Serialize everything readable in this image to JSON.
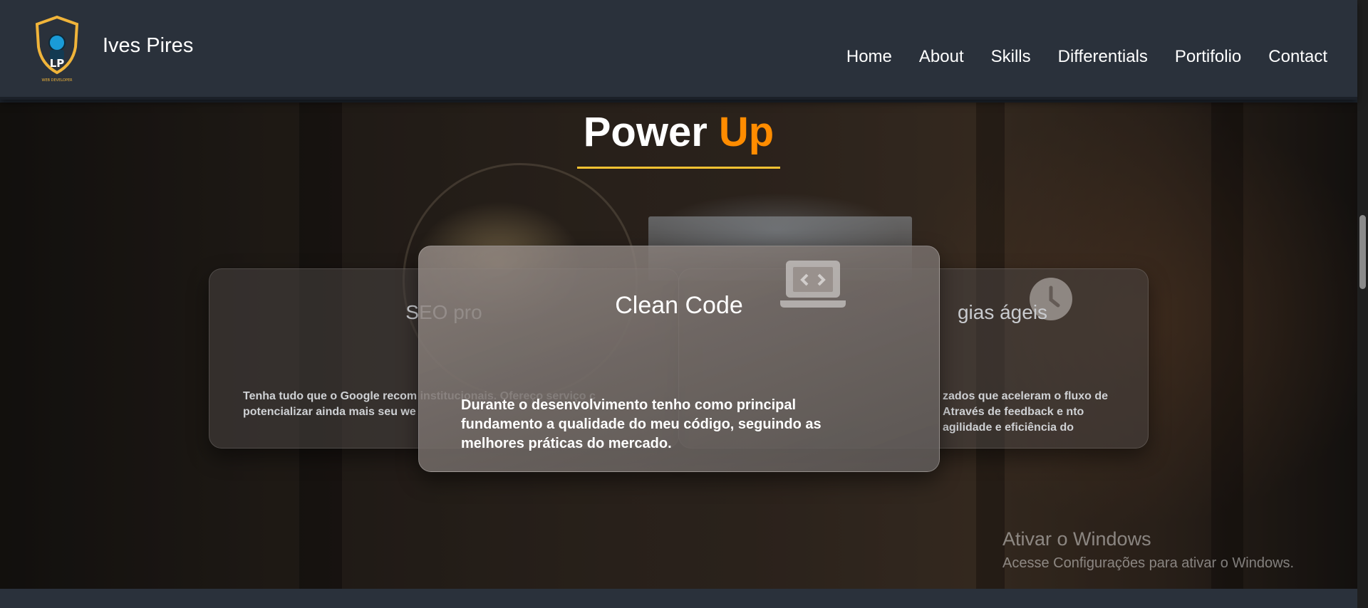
{
  "header": {
    "brand": "Ives Pires",
    "logo_caption": "WEB DEVELOPER",
    "logo_letters": "LP",
    "nav": [
      {
        "label": "Home"
      },
      {
        "label": "About"
      },
      {
        "label": "Skills"
      },
      {
        "label": "Differentials"
      },
      {
        "label": "Portifolio"
      },
      {
        "label": "Contact"
      }
    ]
  },
  "section": {
    "title_main": "Power ",
    "title_accent": "Up",
    "accent_color": "#ff8c00",
    "underline_color": "#f6c232"
  },
  "cards": {
    "left": {
      "title": "SEO pro",
      "text": "Tenha tudo que o Google recom institucionais. Ofereço serviço c potencializar ainda mais seu we"
    },
    "center": {
      "icon": "laptop-code-icon",
      "title": "Clean Code",
      "text": "Durante o desenvolvimento tenho como principal fundamento a qualidade do meu código, seguindo as melhores práticas do mercado."
    },
    "right": {
      "icon": "clock-icon",
      "title": "gias ágeis",
      "text": "zados que aceleram o fluxo de Através de feedback e nto agilidade e eficiência do"
    }
  },
  "watermark": {
    "title": "Ativar o Windows",
    "subtitle": "Acesse Configurações para ativar o Windows."
  }
}
